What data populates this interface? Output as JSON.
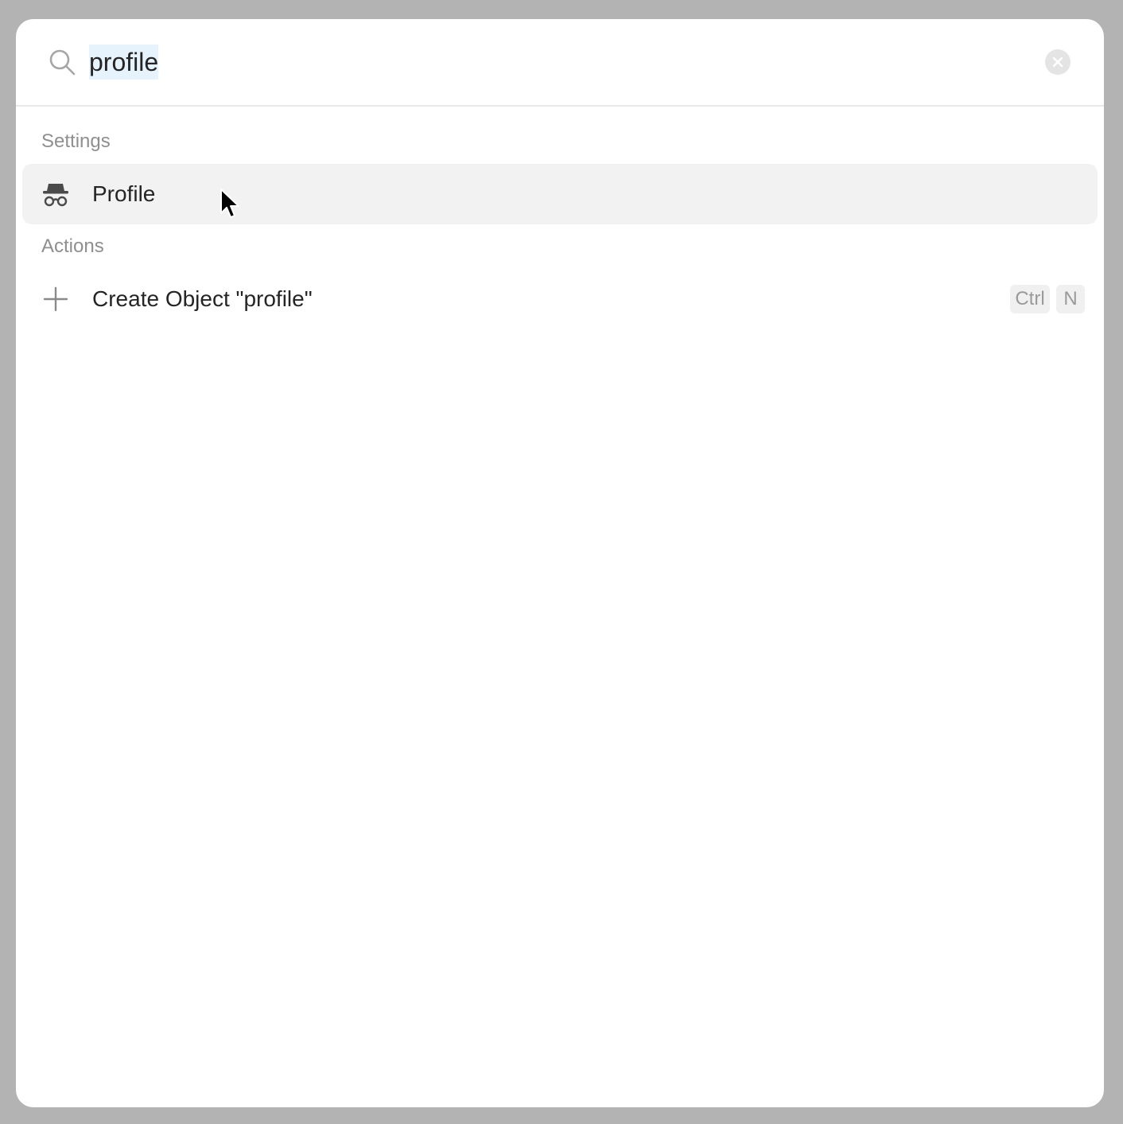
{
  "search": {
    "query": "profile",
    "icon": "search-icon",
    "clear_icon": "close-icon"
  },
  "sections": {
    "settings": {
      "label": "Settings",
      "items": [
        {
          "label": "Profile",
          "icon": "incognito-icon",
          "selected": true
        }
      ]
    },
    "actions": {
      "label": "Actions",
      "items": [
        {
          "label": "Create Object \"profile\"",
          "icon": "plus-icon",
          "shortcut": [
            "Ctrl",
            "N"
          ]
        }
      ]
    }
  },
  "colors": {
    "backdrop": "#b3b3b3",
    "panel": "#ffffff",
    "selected_row": "#f2f2f2",
    "query_highlight": "#e6f2fc",
    "section_label": "#8f8f8f",
    "text": "#252525"
  }
}
